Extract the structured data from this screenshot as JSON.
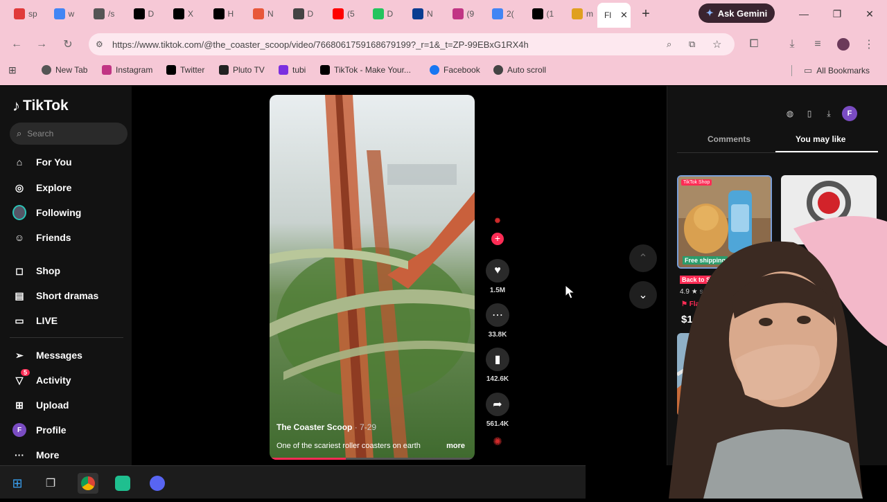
{
  "browser": {
    "tabs": [
      {
        "letter": "sp",
        "color": "#e03a3a"
      },
      {
        "letter": "w",
        "color": "#4285f4"
      },
      {
        "letter": "/s",
        "color": "#555555"
      },
      {
        "letter": "D",
        "color": "#000000"
      },
      {
        "letter": "X",
        "color": "#000000"
      },
      {
        "letter": "H",
        "color": "#000000"
      },
      {
        "letter": "N",
        "color": "#e8573a"
      },
      {
        "letter": "D",
        "color": "#444444"
      },
      {
        "letter": "(5",
        "color": "#ff0000"
      },
      {
        "letter": "D",
        "color": "#23c45e"
      },
      {
        "letter": "N",
        "color": "#0b3d91"
      },
      {
        "letter": "(9",
        "color": "#c13584"
      },
      {
        "letter": "2(",
        "color": "#4285f4"
      },
      {
        "letter": "(1",
        "color": "#000000"
      },
      {
        "letter": "m",
        "color": "#e0a020"
      }
    ],
    "active_tab_label": "Fl",
    "ask_gemini": "Ask Gemini",
    "url": "https://www.tiktok.com/@the_coaster_scoop/video/7668061759168679199?_r=1&_t=ZP-99EBxG1RX4h",
    "bookmarks": [
      "New Tab",
      "Instagram",
      "Twitter",
      "Pluto TV",
      "tubi",
      "TikTok - Make Your...",
      "Facebook",
      "Auto scroll"
    ],
    "all_bookmarks": "All Bookmarks"
  },
  "tiktok": {
    "logo": "TikTok",
    "search_placeholder": "Search",
    "nav": [
      "For You",
      "Explore",
      "Following",
      "Friends",
      "Shop",
      "Short dramas",
      "LIVE",
      "Messages",
      "Activity",
      "Upload",
      "Profile",
      "More"
    ],
    "activity_badge": "5",
    "profile_initial": "F",
    "video": {
      "author": "The Coaster Scoop",
      "date": "7-29",
      "description": "One of the scariest roller coasters on earth",
      "more": "more",
      "progress": 0.37
    },
    "actions": {
      "likes": "1.5M",
      "comments": "33.8K",
      "saves": "142.6K",
      "shares": "561.4K"
    },
    "right_panel": {
      "tab_comments": "Comments",
      "tab_you_may_like": "You may like",
      "avatar_initial": "F",
      "product1": {
        "ribbon": "TikTok Shop",
        "free_shipping": "Free shipping",
        "badge": "Back to School",
        "rating": "4.9",
        "seller": "seo_ke",
        "flash": "Flash sale",
        "price": "$14.99"
      }
    }
  },
  "colors": {
    "accent": "#fe2c55",
    "chrome_bg": "#f6c8d6"
  }
}
